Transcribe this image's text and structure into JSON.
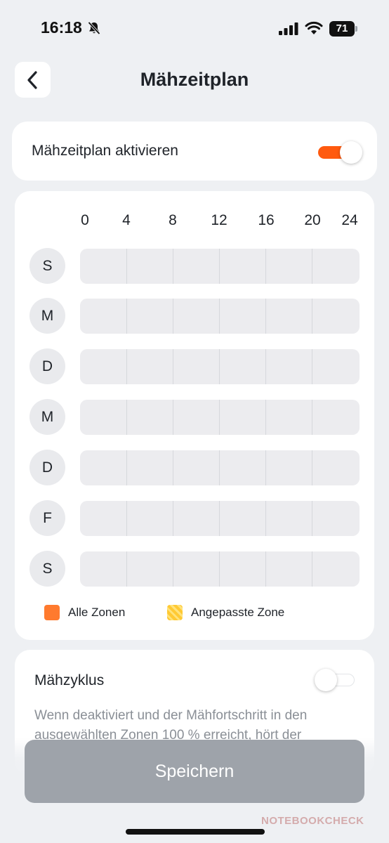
{
  "status_bar": {
    "time": "16:18",
    "battery": "71"
  },
  "header": {
    "title": "Mähzeitplan"
  },
  "activate": {
    "label": "Mähzeitplan aktivieren",
    "enabled": true
  },
  "schedule": {
    "hours": [
      "0",
      "4",
      "8",
      "12",
      "16",
      "20",
      "24"
    ],
    "days": [
      "S",
      "M",
      "D",
      "M",
      "D",
      "F",
      "S"
    ],
    "legend": {
      "all_zones": "Alle Zonen",
      "custom_zone": "Angepasste Zone"
    }
  },
  "cycle": {
    "label": "Mähzyklus",
    "enabled": false,
    "description": "Wenn deaktiviert und der Mähfortschritt in den ausgewählten Zonen 100 % erreicht, hört der"
  },
  "save_label": "Speichern",
  "watermark": "NOTEBOOKCHECK",
  "colors": {
    "accent": "#ff5a0f",
    "all_zones": "#ff7a2e",
    "custom_zone": "#ffc933",
    "save_button": "#9ea3aa"
  }
}
